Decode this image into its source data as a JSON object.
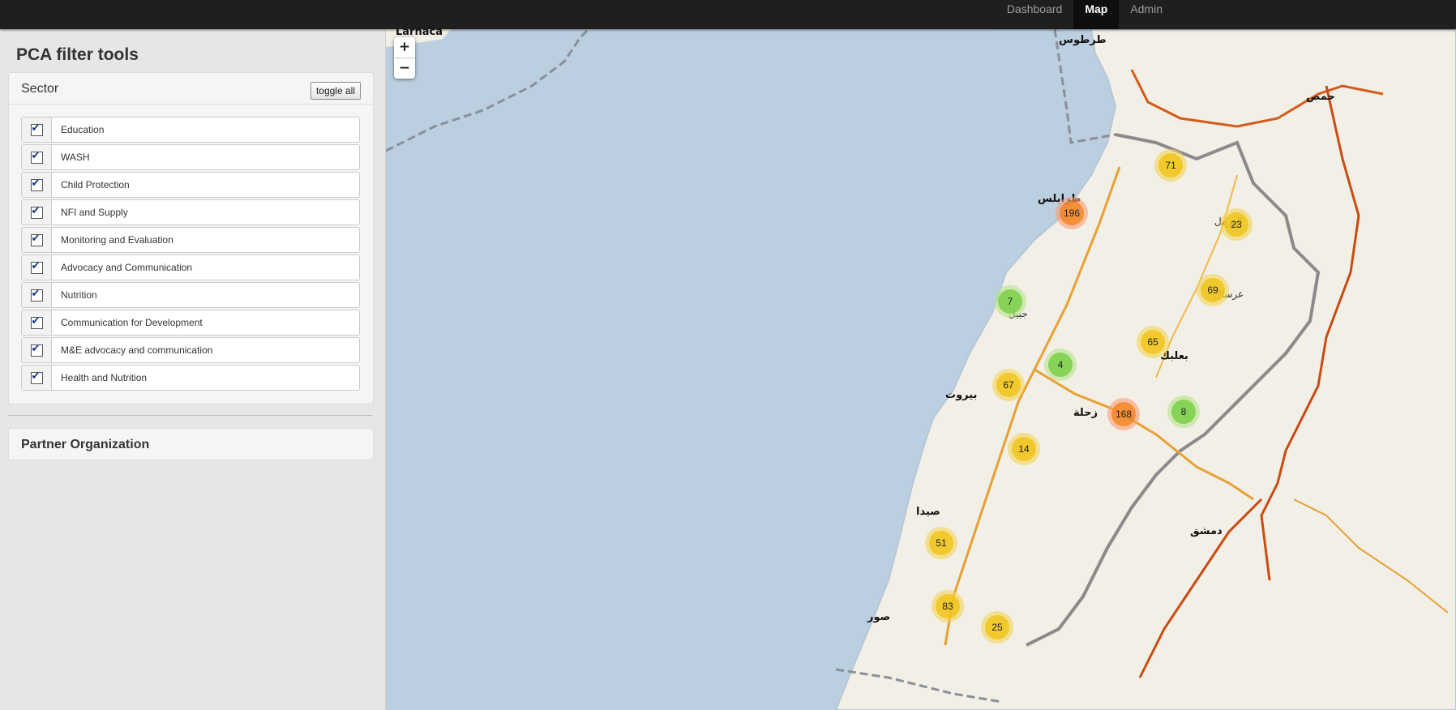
{
  "nav": {
    "items": [
      {
        "label": "Dashboard",
        "active": false
      },
      {
        "label": "Map",
        "active": true
      },
      {
        "label": "Admin",
        "active": false
      }
    ]
  },
  "sidebar": {
    "title": "PCA filter tools",
    "sector": {
      "title": "Sector",
      "toggle_label": "toggle all",
      "items": [
        {
          "label": "Education",
          "checked": true
        },
        {
          "label": "WASH",
          "checked": true
        },
        {
          "label": "Child Protection",
          "checked": true
        },
        {
          "label": "NFI and Supply",
          "checked": true
        },
        {
          "label": "Monitoring and Evaluation",
          "checked": true
        },
        {
          "label": "Advocacy and Communication",
          "checked": true
        },
        {
          "label": "Nutrition",
          "checked": true
        },
        {
          "label": "Communication for Development",
          "checked": true
        },
        {
          "label": "M&E advocacy and communication",
          "checked": true
        },
        {
          "label": "Health and Nutrition",
          "checked": true
        }
      ]
    },
    "partner": {
      "title": "Partner Organization"
    }
  },
  "map": {
    "zoom_in": "+",
    "zoom_out": "−",
    "places": [
      "Larnaca",
      "طرطوس",
      "حمص",
      "طرابلس",
      "بيروت",
      "صيدا",
      "صور",
      "دمشق",
      "بعلبك",
      "زحلة",
      "جبيل",
      "عرسال",
      "الهرمل"
    ],
    "clusters": [
      {
        "count": "71",
        "level": "yellow"
      },
      {
        "count": "196",
        "level": "orange"
      },
      {
        "count": "23",
        "level": "yellow"
      },
      {
        "count": "69",
        "level": "yellow"
      },
      {
        "count": "7",
        "level": "green"
      },
      {
        "count": "65",
        "level": "yellow"
      },
      {
        "count": "4",
        "level": "green"
      },
      {
        "count": "67",
        "level": "yellow"
      },
      {
        "count": "168",
        "level": "orange"
      },
      {
        "count": "8",
        "level": "green"
      },
      {
        "count": "14",
        "level": "yellow"
      },
      {
        "count": "51",
        "level": "yellow"
      },
      {
        "count": "83",
        "level": "yellow"
      },
      {
        "count": "25",
        "level": "yellow"
      }
    ]
  }
}
